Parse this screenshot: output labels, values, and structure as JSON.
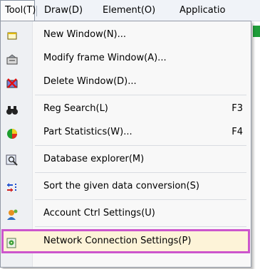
{
  "menubar": {
    "items": [
      {
        "label": "Tool(T)"
      },
      {
        "label": "Draw(D)"
      },
      {
        "label": "Element(O)"
      },
      {
        "label": "Applicatio"
      }
    ]
  },
  "menu": {
    "items": [
      {
        "label": "New Window(N)...",
        "shortcut": "",
        "icon": "new-window-icon"
      },
      {
        "label": "Modify frame Window(A)...",
        "shortcut": "",
        "icon": "modify-frame-icon"
      },
      {
        "label": "Delete Window(D)...",
        "shortcut": "",
        "icon": "delete-window-icon"
      },
      {
        "label": "Reg Search(L)",
        "shortcut": "F3",
        "icon": "binoculars-icon"
      },
      {
        "label": "Part Statistics(W)...",
        "shortcut": "F4",
        "icon": "pie-chart-icon"
      },
      {
        "label": "Database explorer(M)",
        "shortcut": "",
        "icon": "database-search-icon"
      },
      {
        "label": "Sort the given data conversion(S)",
        "shortcut": "",
        "icon": "sort-arrows-icon"
      },
      {
        "label": "Account Ctrl Settings(U)",
        "shortcut": "",
        "icon": "account-settings-icon"
      },
      {
        "label": "Network Connection Settings(P)",
        "shortcut": "",
        "icon": "network-settings-icon"
      }
    ],
    "highlighted_item": "Network Connection Settings(P)",
    "highlight_color": "#cc55cc"
  }
}
